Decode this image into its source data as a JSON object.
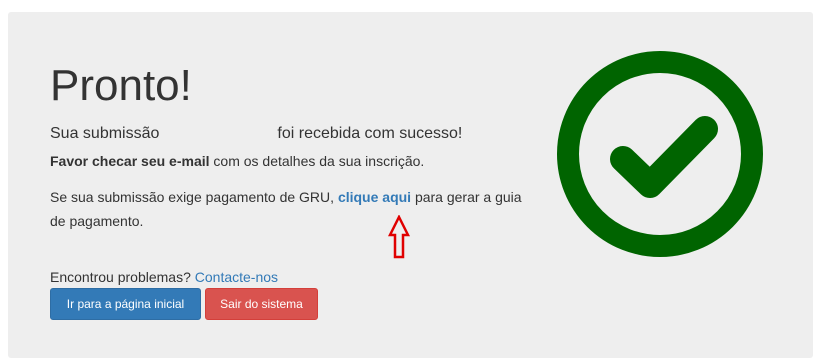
{
  "panel": {
    "title": "Pronto!",
    "submission_prefix": "Sua submissão",
    "submission_suffix": "foi recebida com sucesso!",
    "email_bold": "Favor checar seu e-mail",
    "email_rest": " com os detalhes da sua inscrição.",
    "gru_prefix": "Se sua submissão exige pagamento de GRU, ",
    "gru_link": "clique aqui",
    "gru_suffix": " para gerar a guia de pagamento.",
    "problems_text": "Encontrou problemas? ",
    "contact_link": "Contacte-nos"
  },
  "buttons": {
    "home": "Ir para a página inicial",
    "logout": "Sair do sistema"
  },
  "colors": {
    "success_green": "#006400",
    "primary": "#337ab7",
    "danger": "#d9534f",
    "annotation_arrow": "#e00000"
  },
  "icons": {
    "success": "check-circle-icon",
    "annotation": "arrow-up-outline-icon"
  }
}
